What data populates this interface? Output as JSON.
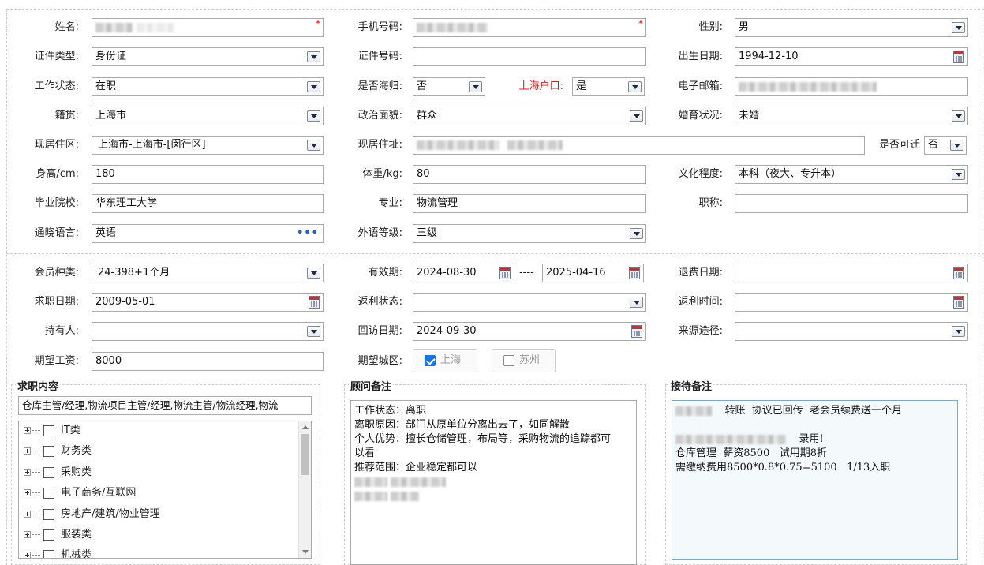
{
  "colors": {
    "label_red": "#d21e1e",
    "required": "#ee0000",
    "check_blue": "#1a73e8"
  },
  "personal": {
    "name": {
      "label": "姓名:",
      "value": ""
    },
    "mobile": {
      "label": "手机号码:",
      "value": ""
    },
    "gender": {
      "label": "性别:",
      "value": "男"
    },
    "id_type": {
      "label": "证件类型:",
      "value": "身份证"
    },
    "id_number": {
      "label": "证件号码:",
      "value": ""
    },
    "birthdate": {
      "label": "出生日期:",
      "value": "1994-12-10"
    },
    "work_status": {
      "label": "工作状态:",
      "value": "在职"
    },
    "returnee": {
      "label": "是否海归:",
      "value": "否"
    },
    "shanghai_hukou": {
      "label": "上海户口:",
      "value": "是"
    },
    "email": {
      "label": "电子邮箱:",
      "value": ""
    },
    "native_place": {
      "label": "籍贯:",
      "value": "上海市"
    },
    "political_status": {
      "label": "政治面貌:",
      "value": "群众"
    },
    "marital_status": {
      "label": "婚育状况:",
      "value": "未婚"
    },
    "residence_area": {
      "label": "现居住区:",
      "value": "上海市-上海市-[闵行区]"
    },
    "residence_address": {
      "label": "现居住址:",
      "value": ""
    },
    "relocatable": {
      "label": "是否可迁",
      "value": "否"
    },
    "height": {
      "label": "身高/cm:",
      "value": "180"
    },
    "weight": {
      "label": "体重/kg:",
      "value": "80"
    },
    "education": {
      "label": "文化程度:",
      "value": "本科（夜大、专升本）"
    },
    "school": {
      "label": "毕业院校:",
      "value": "华东理工大学"
    },
    "major": {
      "label": "专业:",
      "value": "物流管理"
    },
    "title": {
      "label": "职称:",
      "value": ""
    },
    "languages": {
      "label": "通晓语言:",
      "value": "英语"
    },
    "language_level": {
      "label": "外语等级:",
      "value": "三级"
    }
  },
  "membership": {
    "member_type": {
      "label": "会员种类:",
      "value": "24-398+1个月"
    },
    "validity": {
      "label": "有效期:",
      "start": "2024-08-30",
      "separator": "----",
      "end": "2025-04-16"
    },
    "refund_date": {
      "label": "退费日期:",
      "value": ""
    },
    "job_date": {
      "label": "求职日期:",
      "value": "2009-05-01"
    },
    "rebate_status": {
      "label": "返利状态:",
      "value": ""
    },
    "rebate_time": {
      "label": "返利时间:",
      "value": ""
    },
    "holder": {
      "label": "持有人:",
      "value": ""
    },
    "visit_date": {
      "label": "回访日期:",
      "value": "2024-09-30"
    },
    "source": {
      "label": "来源途径:",
      "value": ""
    },
    "expected_salary": {
      "label": "期望工资:",
      "value": "8000"
    },
    "expected_city": {
      "label": "期望城区:",
      "options": [
        {
          "label": "上海",
          "checked": true
        },
        {
          "label": "苏州",
          "checked": false
        }
      ]
    }
  },
  "job_content": {
    "title": "求职内容",
    "selected": "仓库主管/经理,物流项目主管/经理,物流主管/物流经理,物流",
    "tree": [
      {
        "label": "IT类"
      },
      {
        "label": "财务类"
      },
      {
        "label": "采购类"
      },
      {
        "label": "电子商务/互联网"
      },
      {
        "label": "房地产/建筑/物业管理"
      },
      {
        "label": "服装类"
      },
      {
        "label": "机械类"
      }
    ]
  },
  "consultant_notes": {
    "title": "顾问备注",
    "lines": [
      "工作状态：离职",
      "离职原因：部门从原单位分离出去了，如同解散",
      "个人优势：擅长仓储管理，布局等，采购物流的追踪都可",
      "以看",
      "推荐范围：企业稳定都可以"
    ]
  },
  "reception_notes": {
    "title": "接待备注",
    "line1": "转账  协议已回传  老会员续费送一个月",
    "line2": "录用!",
    "line3": "仓库管理  薪资8500   试用期8折",
    "line4": "需缴纳费用8500*0.8*0.75=5100   1/13入职"
  }
}
